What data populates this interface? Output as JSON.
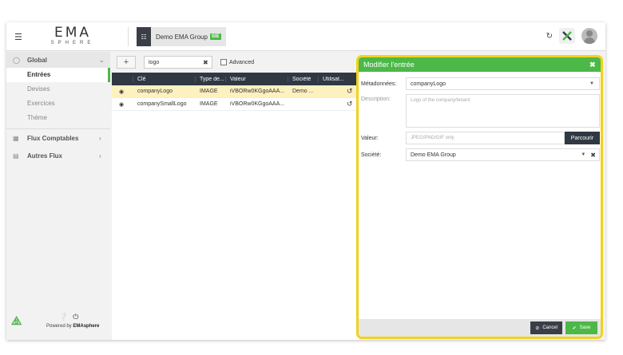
{
  "header": {
    "logo_main": "EMA",
    "logo_sub": "SPHERE",
    "company_name": "Demo EMA Group",
    "company_badge": "SIE"
  },
  "sidebar": {
    "global_label": "Global",
    "sub_items": [
      "Entrées",
      "Devises",
      "Exercices",
      "Thème"
    ],
    "active_item": "Entrées",
    "groups": [
      "Flux Comptables",
      "Autres Flux"
    ],
    "powered_prefix": "Powered by ",
    "powered_brand": "EMAsphere"
  },
  "toolbar": {
    "search_value": "logo",
    "advanced_label": "Advanced"
  },
  "table": {
    "columns": [
      "Clé",
      "Type de...",
      "Valeur",
      "Société",
      "Utilisat..."
    ],
    "rows": [
      {
        "key": "companyLogo",
        "type": "IMAGE",
        "value": "iVBORw0KGgoAAA...",
        "company": "Demo ...",
        "user": ""
      },
      {
        "key": "companySmallLogo",
        "type": "IMAGE",
        "value": "iVBORw0KGgoAAA...",
        "company": "",
        "user": ""
      }
    ]
  },
  "panel": {
    "title": "Modifier l'entrée",
    "metadata_label": "Métadonnées:",
    "metadata_value": "companyLogo",
    "description_label": "Description:",
    "description_placeholder": "Logo of the company/tenant",
    "value_label": "Valeur:",
    "value_placeholder": "JPEG/PNG/GIF only",
    "browse_label": "Parcourir",
    "company_label": "Société:",
    "company_value": "Demo EMA Group",
    "cancel_label": "Cancel",
    "save_label": "Save"
  },
  "colors": {
    "accent_green": "#4cb848",
    "highlight_yellow": "#f2d21a",
    "dark_header": "#2f3843",
    "selected_row": "#fdf1c0"
  }
}
